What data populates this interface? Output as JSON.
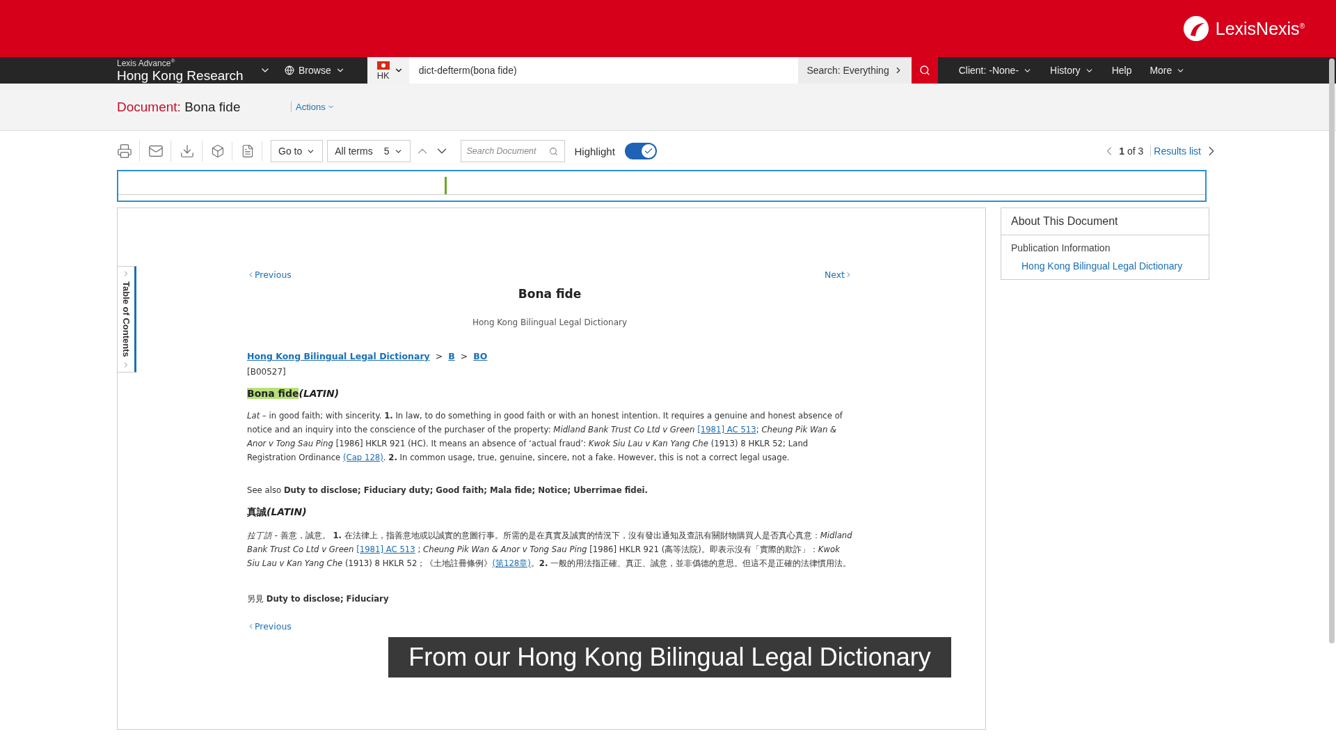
{
  "brand": {
    "name": "LexisNexis$^{®}$"
  },
  "nav": {
    "product_line": "Lexis Advance$^{®}$",
    "product": "Hong Kong Research",
    "browse": "Browse",
    "jurisdiction": "HK",
    "search_value": "dict-defterm(bona fide)",
    "search_scope": "Search: Everything",
    "items": [
      {
        "label": "Client: -None-",
        "has_menu": true
      },
      {
        "label": "History",
        "has_menu": true
      },
      {
        "label": "Help",
        "has_menu": false
      },
      {
        "label": "More",
        "has_menu": true
      }
    ]
  },
  "document_header": {
    "label": "Document:",
    "title": "Bona fide",
    "actions": "Actions"
  },
  "toolbar": {
    "goto": "Go to",
    "terms": "All terms",
    "term_count": "5",
    "search_placeholder": "Search Document",
    "highlight_label": "Highlight",
    "highlight_on": true,
    "page_current": "1",
    "page_of": "of 3",
    "results_list": "Results list"
  },
  "hit_map": {
    "level": 0.3
  },
  "toc_tab": {
    "label": "Table of Contents"
  },
  "document": {
    "previous": "Previous",
    "next": "Next",
    "title": "Bona fide",
    "source": "Hong Kong Bilingual Legal Dictionary",
    "breadcrumb": [
      "Hong Kong Bilingual Legal Dictionary",
      "B",
      "BO"
    ],
    "breadcrumb_separator": ">",
    "code": "[B00527]",
    "headword": {
      "term": "Bona fide",
      "highlighted": true,
      "suffix": "(LATIN)"
    },
    "definition": [
      {
        "kind": "text",
        "text": "*Lat* – in good faith; with sincerity. **1.** In law, to do something in good faith or with an honest intention. It requires a genuine and honest absence of notice and an inquiry into the conscience of the purchaser of the property: *Midland Bank Trust Co Ltd v Green* "
      },
      {
        "kind": "link",
        "text": "[1981] AC 513"
      },
      {
        "kind": "text",
        "text": "; *Cheung Pik Wan & Anor v Tong Sau Ping* [1986] HKLR 921 (HC). It means an absence of ‘actual fraud’: *Kwok Siu Lau v Kan Yang Che* (1913) 8 HKLR 52; Land Registration Ordinance "
      },
      {
        "kind": "link",
        "text": "(Cap 128)"
      },
      {
        "kind": "text",
        "text": ". **2.** In common usage, true, genuine, sincere, not a fake. However, this is not a correct legal usage."
      }
    ],
    "see_also": "See also **Duty to disclose; Fiduciary duty; Good faith; Mala fide; Notice; Uberrimae fidei.**",
    "headword_zh": {
      "term": "真誠",
      "highlighted": false,
      "suffix": "(LATIN)"
    },
    "definition_zh": [
      {
        "kind": "text",
        "text": "*拉丁語* - 善意，誠意。 **1.** 在法律上，指善意地或以誠實的意圖行事。所需的是在真實及誠實的情況下，沒有發出通知及查訊有關財物購買人是否真心真意：*Midland Bank Trust Co Ltd v Green* "
      },
      {
        "kind": "link",
        "text": "[1981] AC 513"
      },
      {
        "kind": "text",
        "text": " ; *Cheung Pik Wan & Anor v Tong Sau Ping* [1986] HKLR 921 (高等法院)。即表示沒有「實際的欺詐」：*Kwok Siu Lau v Kan Yang Che* (1913) 8 HKLR 52；《土地註冊條例》"
      },
      {
        "kind": "link",
        "text": "(第128章)"
      },
      {
        "kind": "text",
        "text": "。**2.** 一般的用法指正確、真正、誠意，並非僞德的意思。但這不是正確的法律慣用法。"
      }
    ],
    "see_also_zh": "另見 **Duty to disclose; Fiduciary**",
    "previous_bottom": "Previous"
  },
  "about": {
    "title": "About This Document",
    "section": "Publication Information",
    "link": "Hong Kong Bilingual Legal Dictionary"
  },
  "caption": "From our Hong Kong Bilingual Legal Dictionary"
}
